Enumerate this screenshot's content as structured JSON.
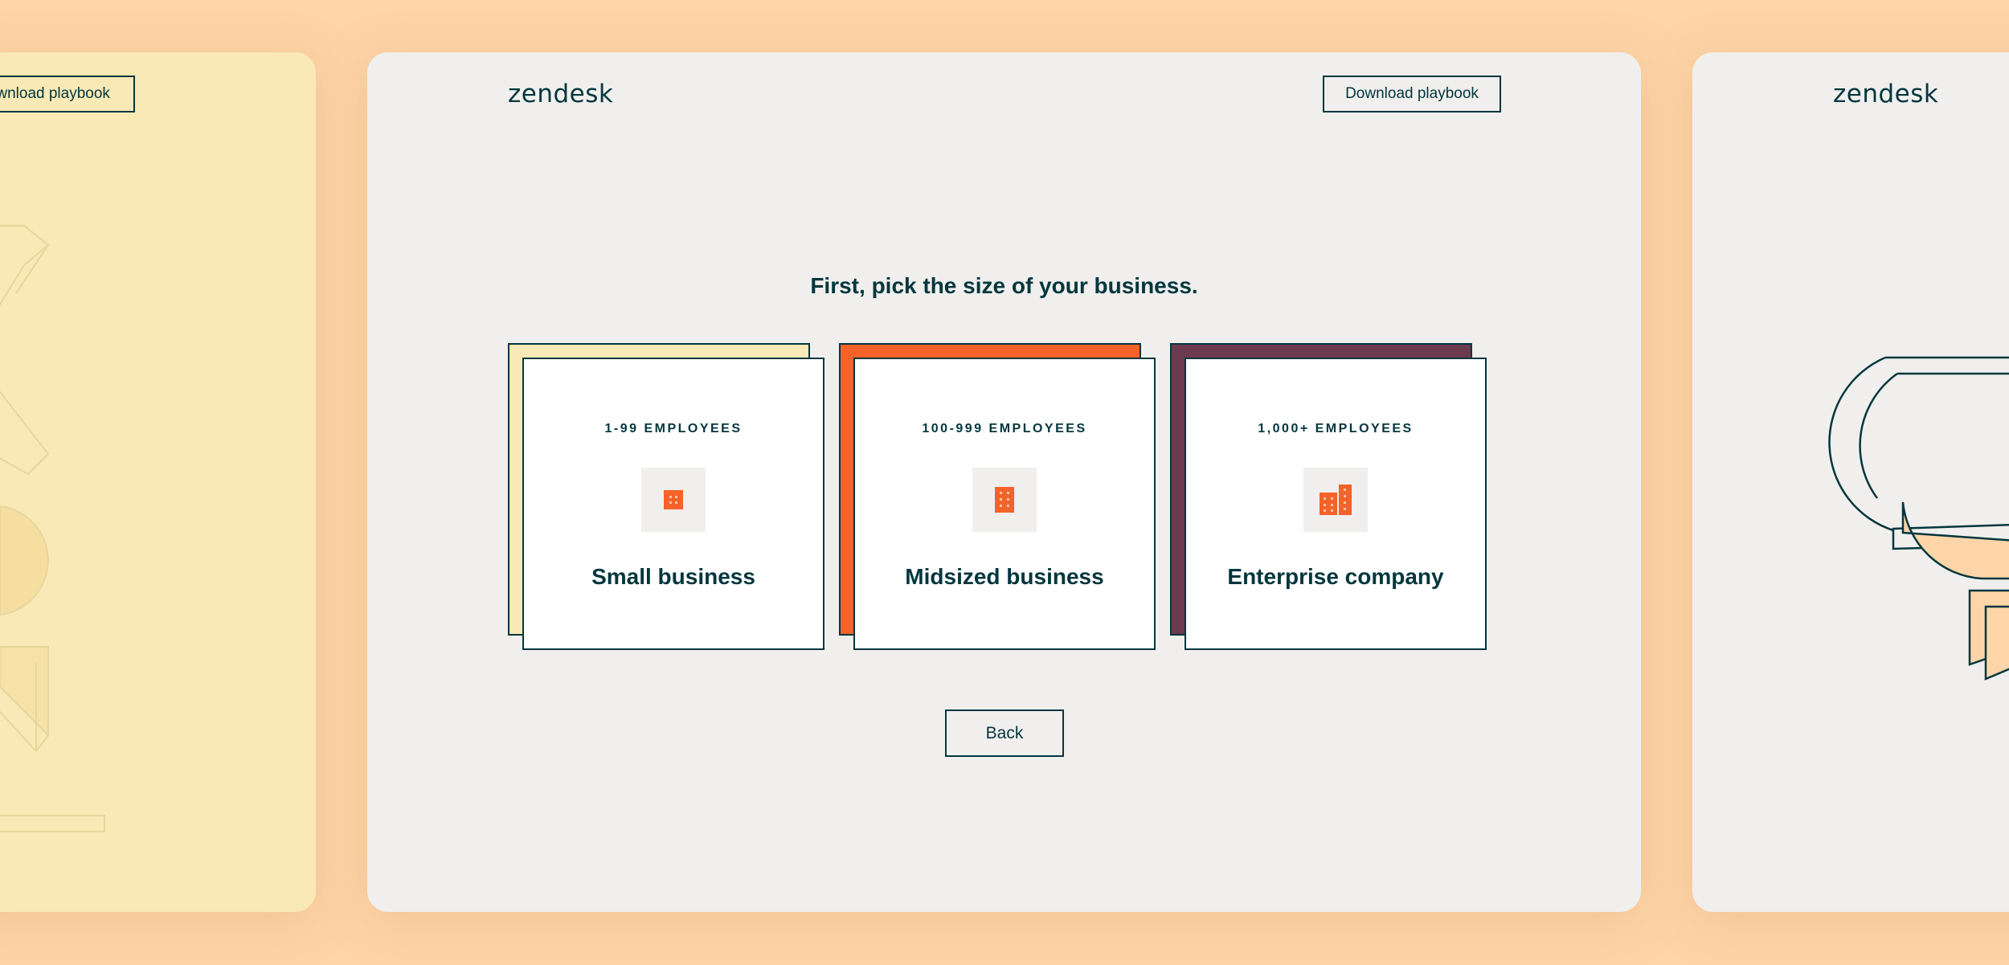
{
  "left_panel": {
    "download_label": "Download playbook"
  },
  "main_panel": {
    "logo": "zendesk",
    "download_label": "Download playbook",
    "heading": "First, pick the size of your business.",
    "cards": [
      {
        "eyebrow": "1-99 EMPLOYEES",
        "title": "Small business",
        "icon": "small-building-icon",
        "back_color": "#f8e9b6"
      },
      {
        "eyebrow": "100-999 EMPLOYEES",
        "title": "Midsized business",
        "icon": "mid-building-icon",
        "back_color": "#f5622a"
      },
      {
        "eyebrow": "1,000+ EMPLOYEES",
        "title": "Enterprise company",
        "icon": "enterprise-buildings-icon",
        "back_color": "#6b3a4f"
      }
    ],
    "back_label": "Back"
  },
  "right_panel": {
    "logo": "zendesk"
  },
  "colors": {
    "page_bg": "#fdd5a9",
    "ink": "#03363d",
    "accent_orange": "#f5622a"
  }
}
